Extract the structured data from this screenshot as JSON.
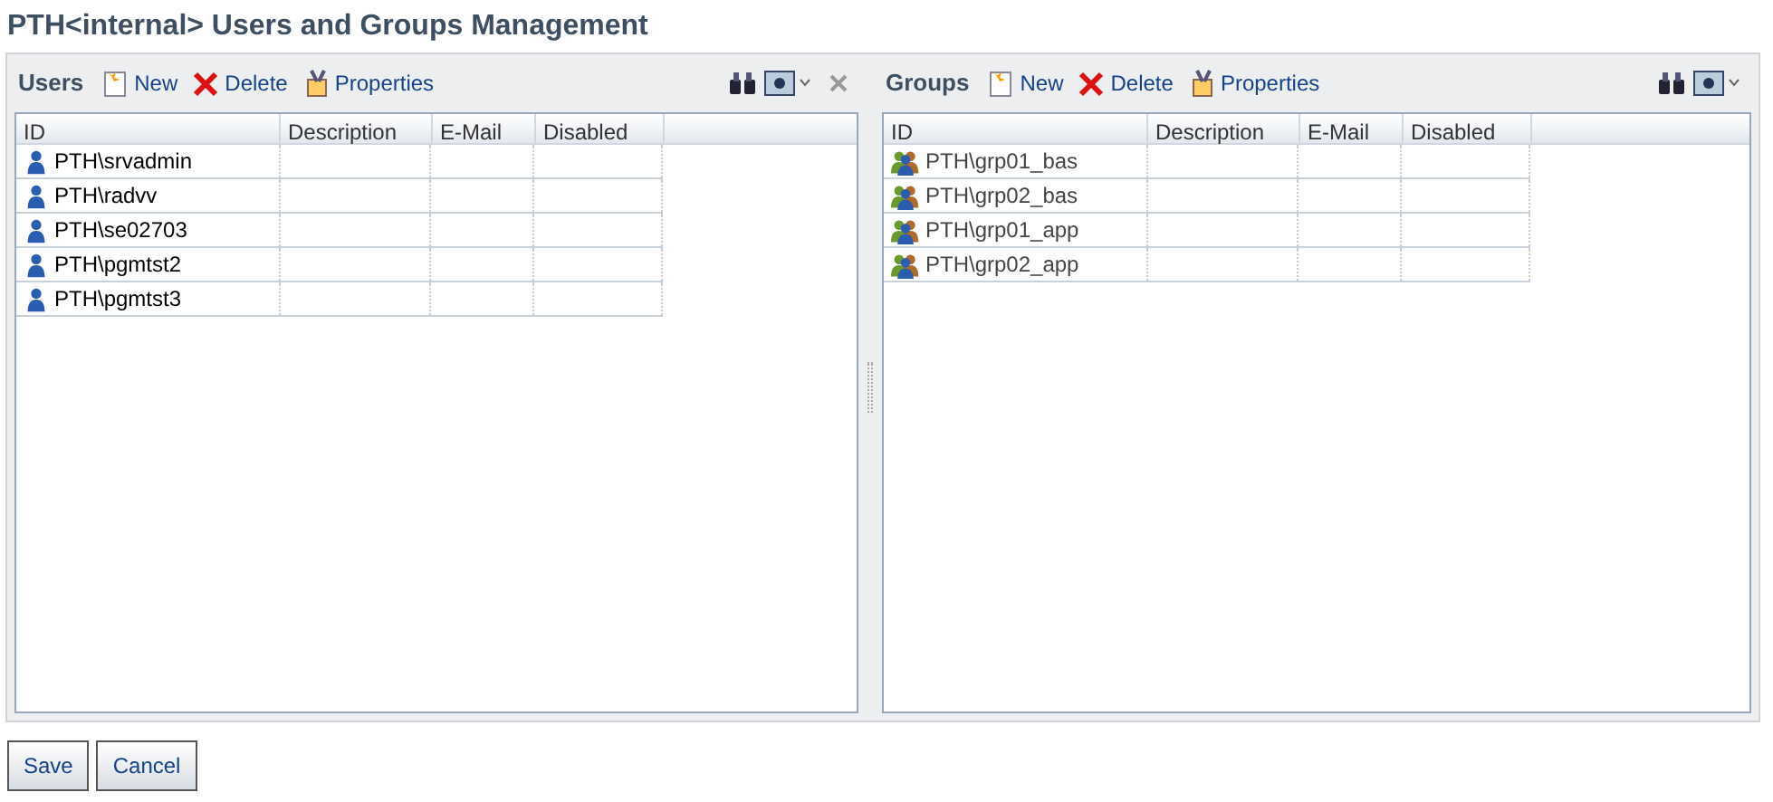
{
  "title": "PTH<internal> Users and Groups Management",
  "panels": [
    {
      "title": "Users",
      "closable": true,
      "toolbar": [
        "New",
        "Delete",
        "Properties"
      ],
      "columns": [
        "ID",
        "Description",
        "E-Mail",
        "Disabled"
      ],
      "rows": [
        {
          "kind": "user",
          "id": "PTH\\srvadmin"
        },
        {
          "kind": "user",
          "id": "PTH\\radvv"
        },
        {
          "kind": "user",
          "id": "PTH\\se02703"
        },
        {
          "kind": "user",
          "id": "PTH\\pgmtst2"
        },
        {
          "kind": "user",
          "id": "PTH\\pgmtst3"
        }
      ]
    },
    {
      "title": "Groups",
      "closable": false,
      "toolbar": [
        "New",
        "Delete",
        "Properties"
      ],
      "columns": [
        "ID",
        "Description",
        "E-Mail",
        "Disabled"
      ],
      "rows": [
        {
          "kind": "group",
          "id": "PTH\\grp01_bas"
        },
        {
          "kind": "group",
          "id": "PTH\\grp02_bas"
        },
        {
          "kind": "group",
          "id": "PTH\\grp01_app"
        },
        {
          "kind": "group",
          "id": "PTH\\grp02_app"
        }
      ]
    }
  ],
  "buttons": [
    "Save",
    "Cancel"
  ]
}
